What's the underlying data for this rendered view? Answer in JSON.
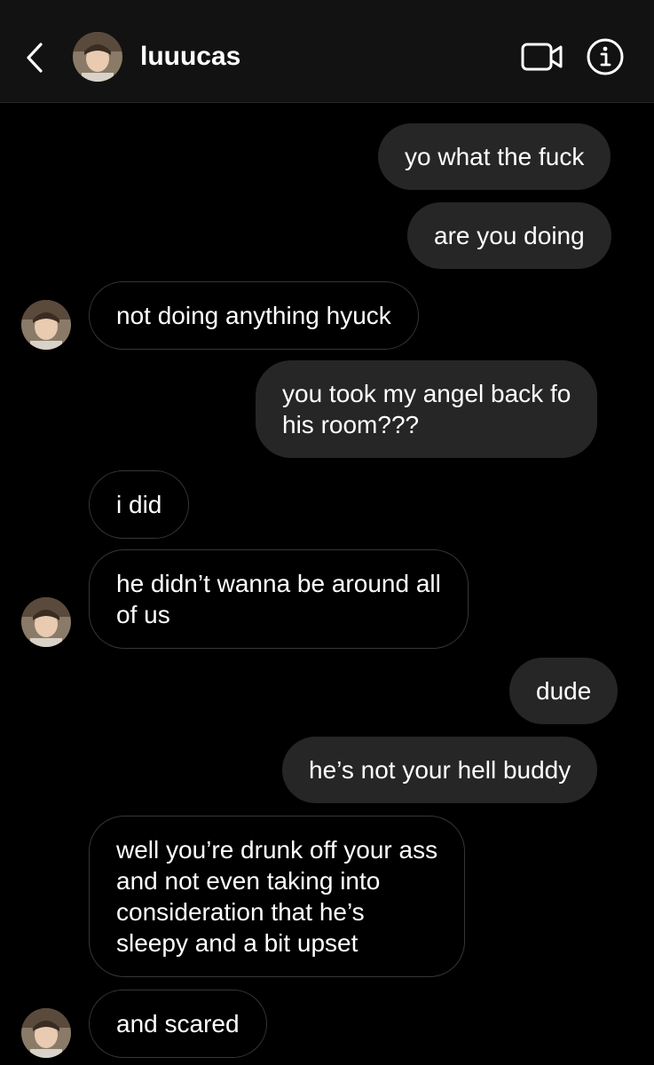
{
  "header": {
    "username": "luuucas",
    "back_icon": "chevron-left-icon",
    "video_icon": "video-camera-icon",
    "info_icon": "info-icon"
  },
  "colors": {
    "background": "#000000",
    "header_background": "#121212",
    "sent_bubble": "#262626",
    "received_border": "#363636",
    "text": "#ffffff"
  },
  "messages": [
    {
      "direction": "sent",
      "lines": [
        "yo what the fuck"
      ]
    },
    {
      "direction": "sent",
      "lines": [
        "are you doing"
      ]
    },
    {
      "direction": "received",
      "lines": [
        "not doing anything hyuck"
      ]
    },
    {
      "direction": "sent",
      "lines": [
        "you took my angel back fo",
        "his room???"
      ]
    },
    {
      "direction": "received",
      "lines": [
        "i did"
      ]
    },
    {
      "direction": "received",
      "lines": [
        "he didn’t wanna be around all",
        "of us"
      ]
    },
    {
      "direction": "sent",
      "lines": [
        "dude"
      ]
    },
    {
      "direction": "sent",
      "lines": [
        "he’s not your hell buddy"
      ]
    },
    {
      "direction": "received",
      "lines": [
        "well you’re drunk off your ass",
        "and not even taking into",
        "consideration that he’s",
        "sleepy and a bit upset"
      ]
    },
    {
      "direction": "received",
      "lines": [
        "and scared"
      ]
    }
  ]
}
